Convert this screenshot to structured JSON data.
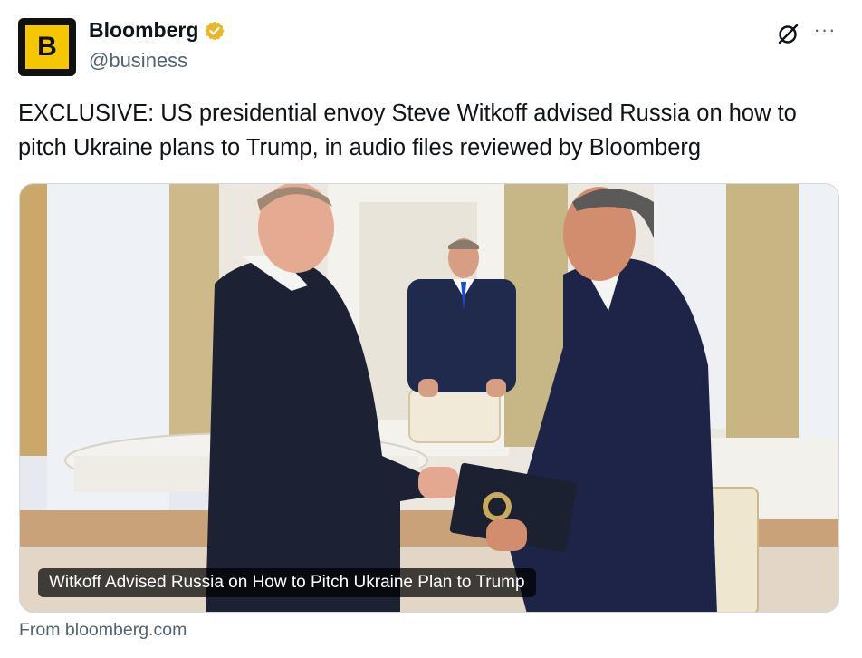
{
  "account": {
    "avatar_letter": "B",
    "display_name": "Bloomberg",
    "handle": "@business",
    "verified_color": "#e8b829"
  },
  "actions": {
    "grok_icon": "grok-icon",
    "more_icon": "more-icon",
    "more_symbol": "···"
  },
  "tweet": {
    "text": "EXCLUSIVE: US presidential envoy Steve Witkoff advised Russia on how to pitch Ukraine plans to Trump, in audio files reviewed by Bloomberg"
  },
  "card": {
    "title": "Witkoff Advised Russia on How to Pitch Ukraine Plan to Trump",
    "source": "From bloomberg.com"
  },
  "colors": {
    "brand_yellow": "#f5c700",
    "text_primary": "#0f1419",
    "text_secondary": "#536471"
  }
}
